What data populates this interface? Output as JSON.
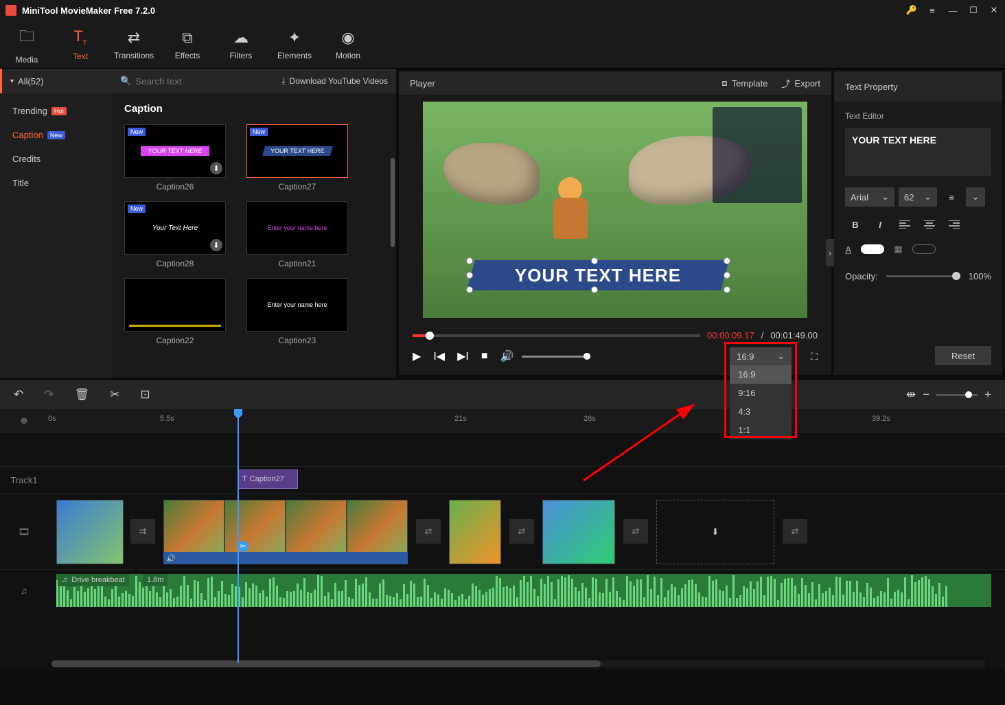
{
  "titlebar": {
    "title": "MiniTool MovieMaker Free 7.2.0"
  },
  "toolbar": {
    "items": [
      {
        "label": "Media"
      },
      {
        "label": "Text"
      },
      {
        "label": "Transitions"
      },
      {
        "label": "Effects"
      },
      {
        "label": "Filters"
      },
      {
        "label": "Elements"
      },
      {
        "label": "Motion"
      }
    ]
  },
  "sidebar": {
    "all_label": "All(52)",
    "items": [
      {
        "label": "Trending",
        "badge": "Hot"
      },
      {
        "label": "Caption",
        "badge": "New"
      },
      {
        "label": "Credits"
      },
      {
        "label": "Title"
      }
    ]
  },
  "browser": {
    "search_placeholder": "Search text",
    "download_link": "Download YouTube Videos",
    "heading": "Caption",
    "thumbs": [
      {
        "label": "Caption26",
        "new": true,
        "inner": "YOUR TEXT HERE"
      },
      {
        "label": "Caption27",
        "new": true,
        "inner": "YOUR TEXT HERE"
      },
      {
        "label": "Caption28",
        "new": true,
        "inner": "Your Text Here"
      },
      {
        "label": "Caption21",
        "inner": "Enter your name here"
      },
      {
        "label": "Caption22",
        "inner": ""
      },
      {
        "label": "Caption23",
        "inner": "Enter your name here"
      }
    ]
  },
  "player": {
    "title": "Player",
    "template_label": "Template",
    "export_label": "Export",
    "overlay_text": "YOUR TEXT HERE",
    "time_current": "00:00:09.17",
    "time_total": "00:01:49.00",
    "aspect_selected": "16:9",
    "aspect_options": [
      "16:9",
      "9:16",
      "4:3",
      "1:1"
    ]
  },
  "properties": {
    "title": "Text Property",
    "editor_label": "Text Editor",
    "text_value": "YOUR TEXT HERE",
    "font_family": "Arial",
    "font_size": "62",
    "opacity_label": "Opacity:",
    "opacity_value": "100%",
    "reset_label": "Reset",
    "fill_color": "#ffffff",
    "stroke_color": "#cccccc"
  },
  "timeline": {
    "ticks": [
      "0s",
      "5.5s",
      "21s",
      "26s",
      "39.2s"
    ],
    "track1_label": "Track1",
    "text_clip_label": "Caption27",
    "audio_clip_label": "Drive breakbeat",
    "audio_clip_duration": "1.8m"
  }
}
